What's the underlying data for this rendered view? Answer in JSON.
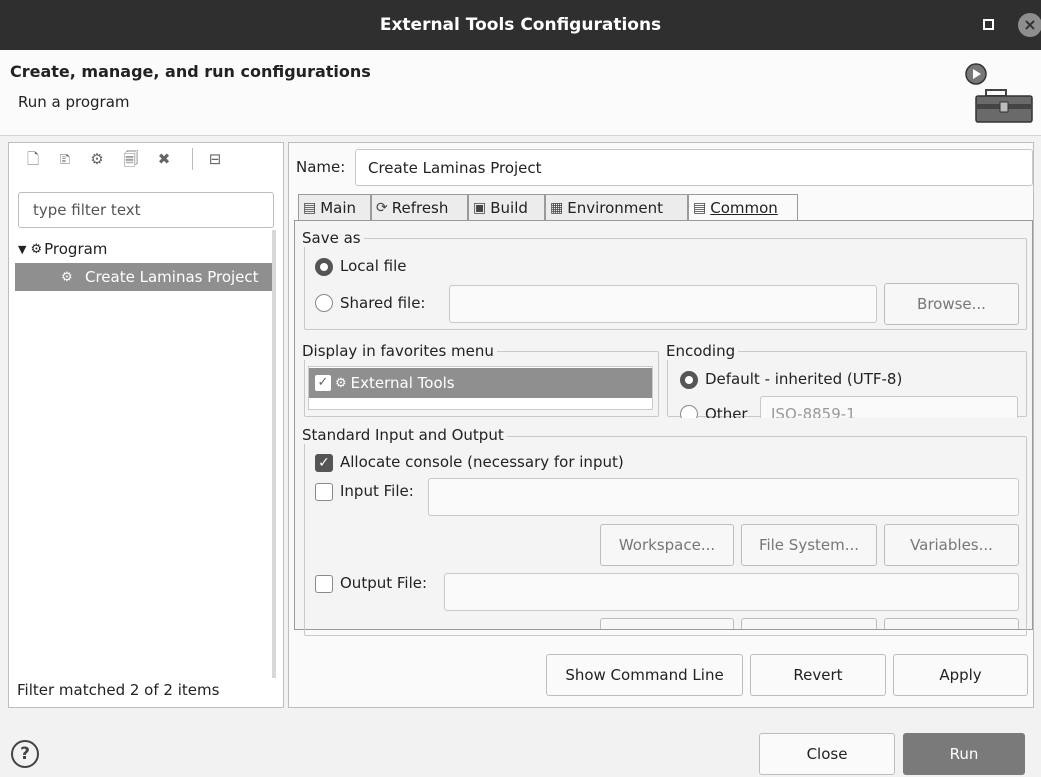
{
  "window": {
    "title": "External Tools Configurations"
  },
  "header": {
    "title": "Create, manage, and run configurations",
    "subtitle": "Run a program"
  },
  "left": {
    "filter_placeholder": "type filter text",
    "tree": {
      "category": "Program",
      "selected_item": "Create Laminas Project"
    },
    "status": "Filter matched 2 of 2 items"
  },
  "config": {
    "name_label": "Name:",
    "name_value": "Create Laminas Project",
    "tabs": [
      {
        "label": "Main",
        "icon": "main-tab-icon"
      },
      {
        "label": "Refresh",
        "icon": "refresh-icon"
      },
      {
        "label": "Build",
        "icon": "build-icon"
      },
      {
        "label": "Environment",
        "icon": "environment-icon"
      },
      {
        "label": "Common",
        "icon": "common-tab-icon",
        "active": true
      }
    ],
    "save_as": {
      "label": "Save as",
      "local_file": "Local file",
      "shared_file": "Shared file:",
      "browse": "Browse..."
    },
    "favorites": {
      "label": "Display in favorites menu",
      "items": [
        "External Tools"
      ]
    },
    "encoding": {
      "label": "Encoding",
      "default_option": "Default - inherited (UTF-8)",
      "other_option": "Other",
      "other_value": "ISO-8859-1"
    },
    "stdio": {
      "label": "Standard Input and Output",
      "allocate_console": "Allocate console (necessary for input)",
      "input_file": "Input File:",
      "workspace": "Workspace...",
      "file_system": "File System...",
      "variables": "Variables...",
      "output_file": "Output File:"
    },
    "buttons": {
      "show_command_line": "Show Command Line",
      "revert": "Revert",
      "apply": "Apply"
    }
  },
  "footer": {
    "close": "Close",
    "run": "Run"
  }
}
